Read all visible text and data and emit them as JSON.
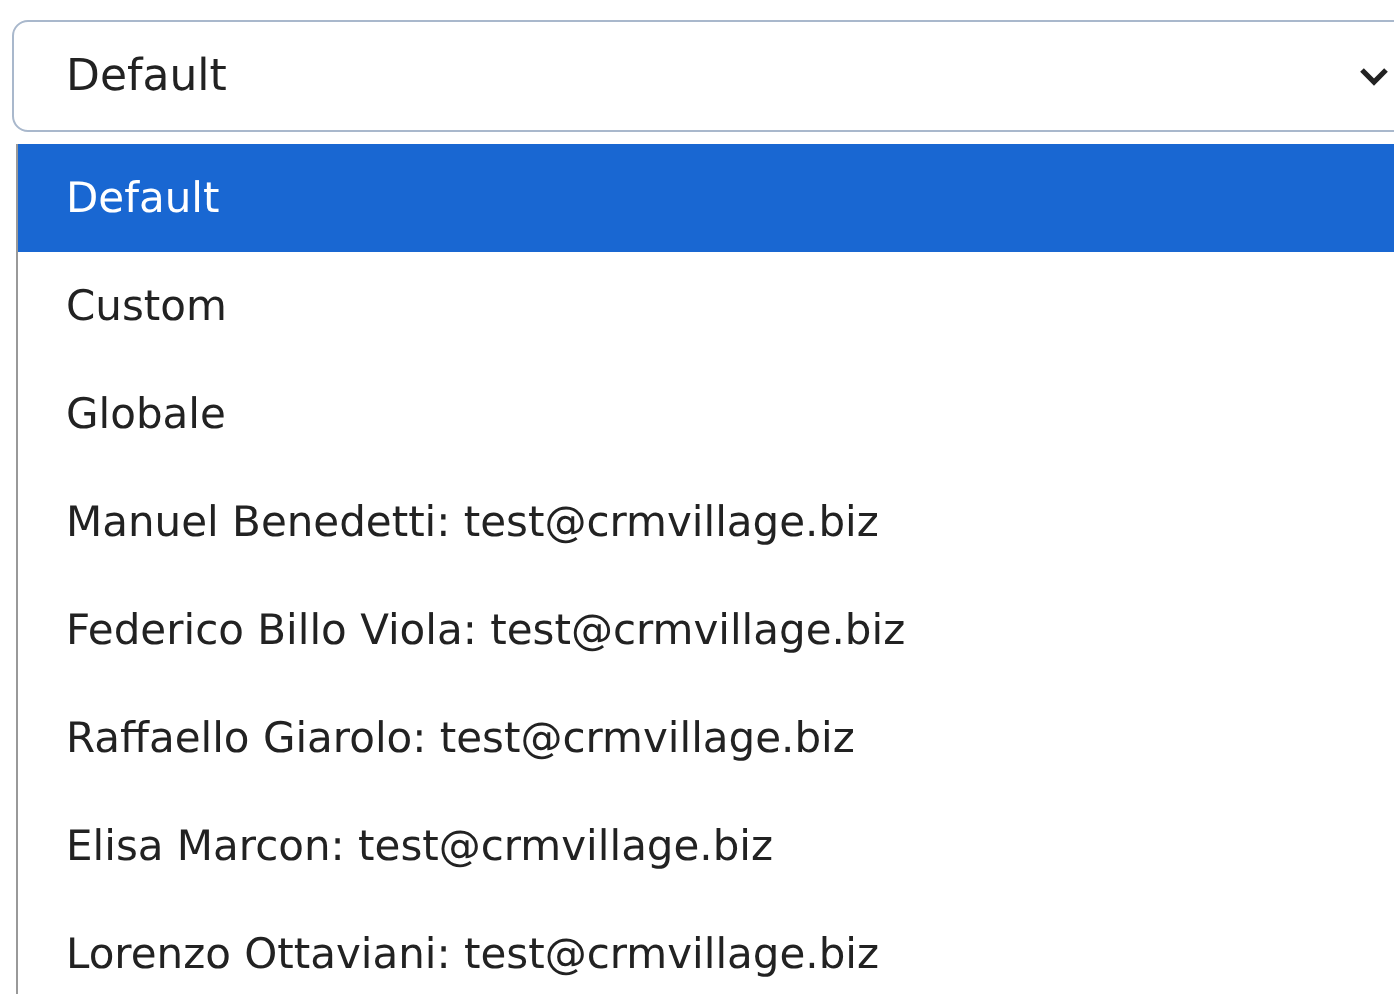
{
  "select": {
    "value": "Default"
  },
  "options": [
    {
      "label": "Default",
      "selected": true
    },
    {
      "label": "Custom",
      "selected": false
    },
    {
      "label": "Globale",
      "selected": false
    },
    {
      "label": "Manuel Benedetti: test@crmvillage.biz",
      "selected": false
    },
    {
      "label": "Federico Billo Viola: test@crmvillage.biz",
      "selected": false
    },
    {
      "label": "Raffaello Giarolo: test@crmvillage.biz",
      "selected": false
    },
    {
      "label": "Elisa Marcon: test@crmvillage.biz",
      "selected": false
    },
    {
      "label": "Lorenzo Ottaviani: test@crmvillage.biz",
      "selected": false
    }
  ]
}
